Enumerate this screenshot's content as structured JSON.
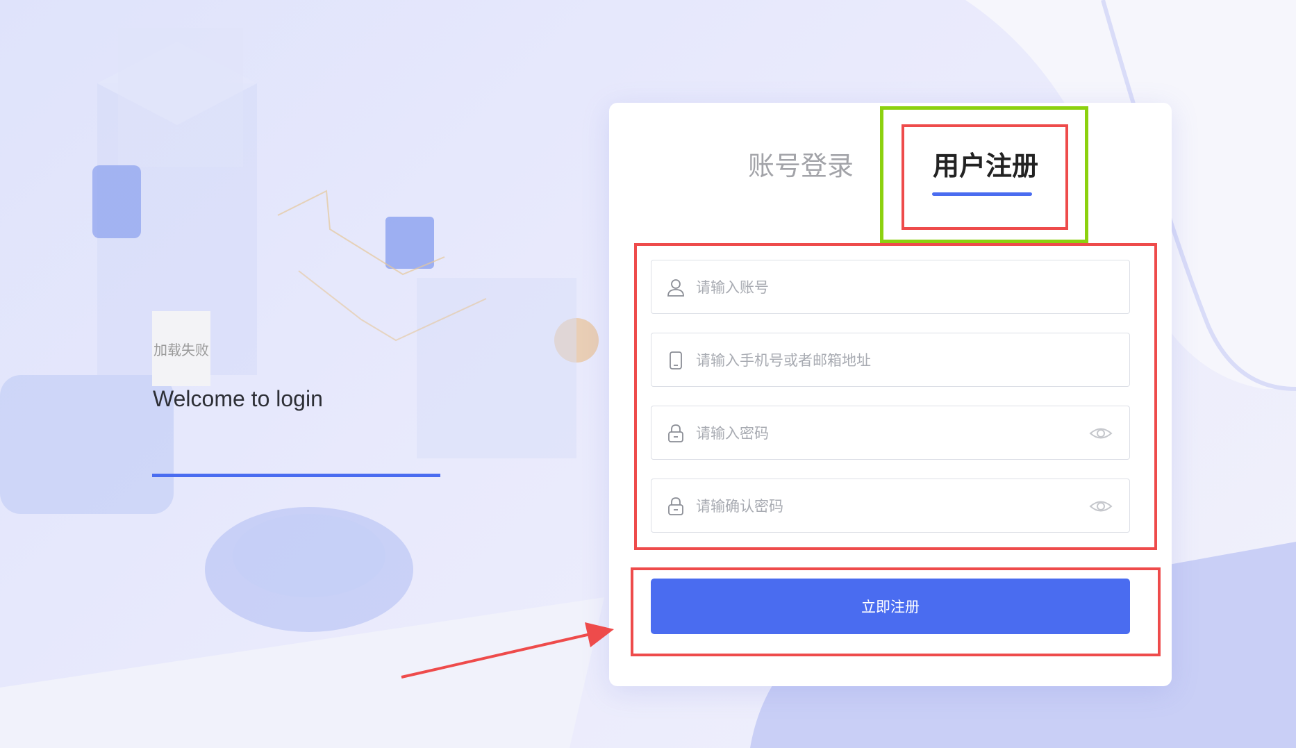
{
  "left_panel": {
    "logo_fail_text": "加载失败",
    "welcome_text": "Welcome to login"
  },
  "tabs": {
    "login_label": "账号登录",
    "register_label": "用户注册",
    "active": "register"
  },
  "form": {
    "account_placeholder": "请输入账号",
    "contact_placeholder": "请输入手机号或者邮箱地址",
    "password_placeholder": "请输入密码",
    "confirm_placeholder": "请输确认密码",
    "submit_label": "立即注册"
  },
  "icons": {
    "account": "user-icon",
    "contact": "phone-icon",
    "password": "lock-icon",
    "confirm": "lock-icon",
    "toggle": "eye-icon"
  },
  "colors": {
    "accent": "#4a6cf0",
    "annotation_red": "#ee4b4b",
    "annotation_green": "#8cd10f"
  }
}
